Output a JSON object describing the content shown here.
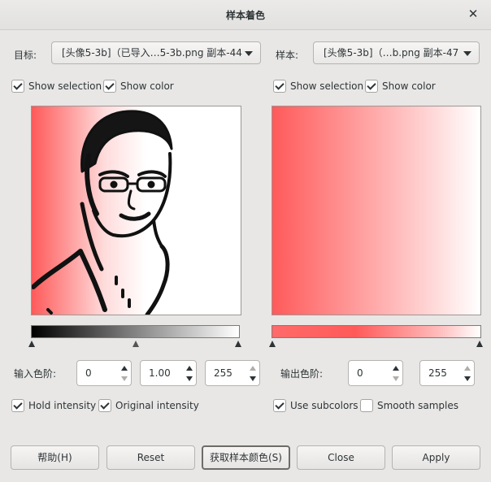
{
  "window": {
    "title": "样本着色"
  },
  "target": {
    "label": "目标:",
    "value": "[头像5-3b]（已导入…5-3b.png 副本-44",
    "show_selection": {
      "label": "Show selection",
      "checked": true
    },
    "show_color": {
      "label": "Show color",
      "checked": true
    }
  },
  "sample": {
    "label": "样本:",
    "value": "[头像5-3b]（…b.png 副本-47",
    "show_selection": {
      "label": "Show selection",
      "checked": true
    },
    "show_color": {
      "label": "Show color",
      "checked": true
    }
  },
  "input_levels": {
    "label": "输入色阶:",
    "low": "0",
    "gamma": "1.00",
    "high": "255"
  },
  "output_levels": {
    "label": "输出色阶:",
    "low": "0",
    "high": "255"
  },
  "options": {
    "hold_intensity": {
      "label": "Hold intensity",
      "checked": true
    },
    "original_intensity": {
      "label": "Original intensity",
      "checked": true
    },
    "use_subcolors": {
      "label": "Use subcolors",
      "checked": true
    },
    "smooth_samples": {
      "label": "Smooth samples",
      "checked": false
    }
  },
  "buttons": {
    "help": "帮助(H)",
    "reset": "Reset",
    "get_sample_colors": "获取样本颜色(S)",
    "close": "Close",
    "apply": "Apply"
  },
  "colors": {
    "accent_red": "#ff5a5a",
    "window_bg": "#e8e7e6"
  },
  "icons": {
    "close": "close-icon",
    "check": "check-icon",
    "dropdown": "chevron-down-icon"
  }
}
